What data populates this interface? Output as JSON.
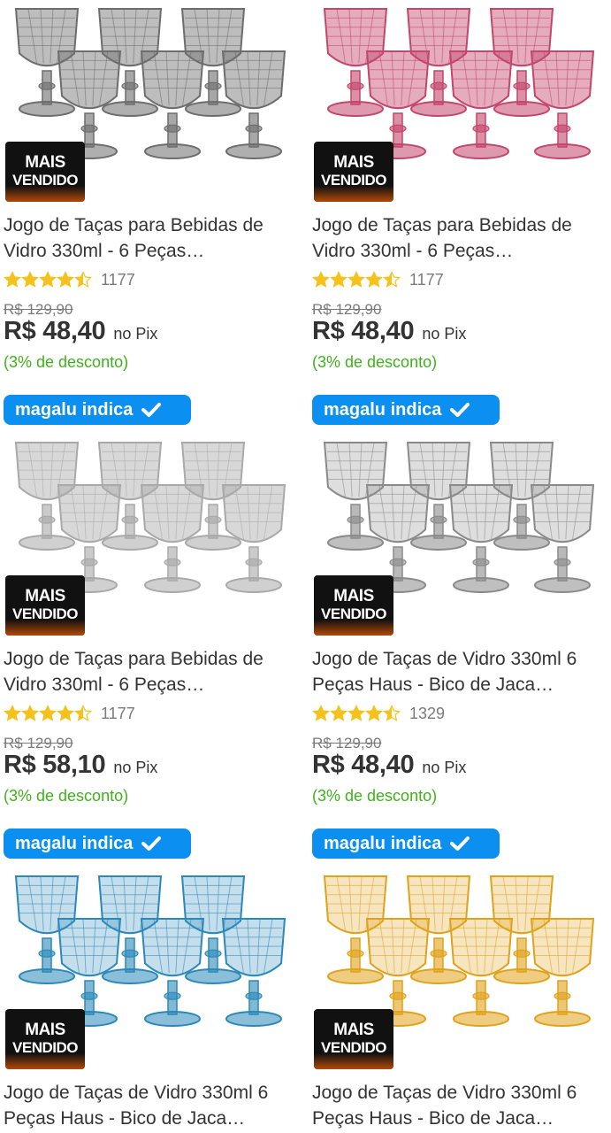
{
  "products": [
    {
      "title": "Jogo de Taças para Bebidas de Vidro 330ml - 6 Peças…",
      "badge": {
        "line1": "MAIS",
        "line2": "VENDIDO"
      },
      "rating_value": 4.5,
      "rating_count": "1177",
      "old_price": "R$ 129,90",
      "price": "R$ 48,40",
      "payment": "no Pix",
      "discount": "(3% de desconto)",
      "tag": "magalu indica",
      "image": "glass-goblets-smoke",
      "glass_color": "#6d6d6d"
    },
    {
      "title": "Jogo de Taças para Bebidas de Vidro 330ml - 6 Peças…",
      "badge": {
        "line1": "MAIS",
        "line2": "VENDIDO"
      },
      "rating_value": 4.5,
      "rating_count": "1177",
      "old_price": "R$ 129,90",
      "price": "R$ 48,40",
      "payment": "no Pix",
      "discount": "(3% de desconto)",
      "tag": "magalu indica",
      "image": "glass-goblets-pink",
      "glass_color": "#c3466c"
    },
    {
      "title": "Jogo de Taças para Bebidas de Vidro 330ml - 6 Peças…",
      "badge": {
        "line1": "MAIS",
        "line2": "VENDIDO"
      },
      "rating_value": 4.5,
      "rating_count": "1177",
      "old_price": "R$ 129,90",
      "price": "R$ 58,10",
      "payment": "no Pix",
      "discount": "(3% de desconto)",
      "tag": "magalu indica",
      "image": "glass-goblets-clear",
      "glass_color": "#a9a9a9"
    },
    {
      "title": "Jogo de Taças de Vidro 330ml 6 Peças Haus - Bico de Jaca…",
      "badge": {
        "line1": "MAIS",
        "line2": "VENDIDO"
      },
      "rating_value": 4.5,
      "rating_count": "1329",
      "old_price": "R$ 129,90",
      "price": "R$ 48,40",
      "payment": "no Pix",
      "discount": "(3% de desconto)",
      "tag": "magalu indica",
      "image": "glass-goblets-clear-diamond",
      "glass_color": "#8a8a8a"
    },
    {
      "title": "Jogo de Taças de Vidro 330ml 6 Peças Haus - Bico de Jaca…",
      "badge": {
        "line1": "MAIS",
        "line2": "VENDIDO"
      },
      "image": "glass-goblets-blue",
      "glass_color": "#2b89b9"
    },
    {
      "title": "Jogo de Taças de Vidro 330ml 6 Peças Haus - Bico de Jaca…",
      "badge": {
        "line1": "MAIS",
        "line2": "VENDIDO"
      },
      "image": "glass-goblets-amber",
      "glass_color": "#e0a21a"
    }
  ],
  "colors": {
    "star": "#f4c21b",
    "discount": "#3fb11b",
    "magalu_blue": "#0b8ff0"
  }
}
